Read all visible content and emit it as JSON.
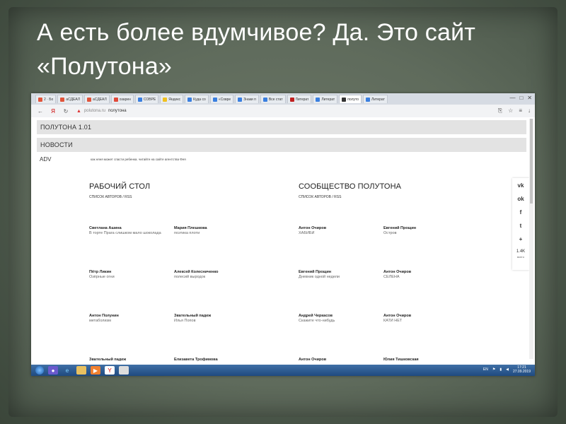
{
  "slide": {
    "title": "А есть более вдумчивое? Да. Это сайт «Полутона»"
  },
  "browser": {
    "tabs": [
      {
        "label": "2 · Бо",
        "color": "#e0543a"
      },
      {
        "label": "аСДЕАЛ",
        "color": "#e0543a"
      },
      {
        "label": "аСДЕАЛ",
        "color": "#e0543a"
      },
      {
        "label": "озарен",
        "color": "#e04a3a"
      },
      {
        "label": "СОВРЕ",
        "color": "#3a7fe0"
      },
      {
        "label": "Яндекс",
        "color": "#f0c020"
      },
      {
        "label": "Куда со",
        "color": "#3a7fe0"
      },
      {
        "label": "«Совре",
        "color": "#3a7fe0"
      },
      {
        "label": "Знаки п",
        "color": "#3a7fe0"
      },
      {
        "label": "Все стат",
        "color": "#3a7fe0"
      },
      {
        "label": "Литерат",
        "color": "#c02020"
      },
      {
        "label": "Литерат",
        "color": "#3a7fe0"
      },
      {
        "label": "полуто",
        "color": "#333333",
        "active": true
      },
      {
        "label": "Литерат",
        "color": "#3a7fe0"
      }
    ],
    "window_controls": {
      "minimize": "—",
      "maximize": "□",
      "close": "✕"
    },
    "address": {
      "domain": "polutona.ru",
      "title": "полутона"
    },
    "nav": {
      "back": "←",
      "yandex": "Я",
      "reload": "↻"
    }
  },
  "site": {
    "header_title": "ПОЛУТОНА 1.01",
    "news_label": "НОВОСТИ",
    "adv_label": "ADV",
    "adv_text": "как няня может спасти ребенка. читайте на сайте агентства Фея",
    "columns": [
      {
        "title": "РАБОЧИЙ СТОЛ",
        "subtitle": "СПИСОК АВТОРОВ / RSS",
        "authors": [
          {
            "name": "Светлана Ашина",
            "post": "В торте Прага слишком мало шоколада"
          },
          {
            "name": "Мария Плешкова",
            "post": "поэтика плоти"
          },
          {
            "name": "Пётр Ликин",
            "post": "Озёрные огни"
          },
          {
            "name": "Алексей Колесниченко",
            "post": "полесий выродок"
          },
          {
            "name": "Антон Полунин",
            "post": "метаболизм"
          },
          {
            "name": "Звательный падеж",
            "post": "Илья Попов"
          },
          {
            "name": "Звательный падеж",
            "post": ""
          },
          {
            "name": "Елизавета Трофимова",
            "post": ""
          }
        ]
      },
      {
        "title": "СООБЩЕСТВО ПОЛУТОНА",
        "subtitle": "СПИСОК АВТОРОВ / RSS",
        "authors": [
          {
            "name": "Антон Очиров",
            "post": "ХАБИБИ"
          },
          {
            "name": "Евгений Прощин",
            "post": "Остров"
          },
          {
            "name": "Евгений Прощин",
            "post": "Дневник одной недели"
          },
          {
            "name": "Антон Очиров",
            "post": "СЕЛЕНА"
          },
          {
            "name": "Андрей Черкасов",
            "post": "Скажите что-нибудь"
          },
          {
            "name": "Антон Очиров",
            "post": "КАТИ НЕТ"
          },
          {
            "name": "Антон Очиров",
            "post": ""
          },
          {
            "name": "Юлия Тишковская",
            "post": ""
          }
        ]
      }
    ],
    "share": {
      "vk": "vk",
      "ok": "ok",
      "fb": "f",
      "tw": "t",
      "plus": "+",
      "count": "1.4K",
      "count_label": "всего"
    }
  },
  "taskbar": {
    "lang": "EN",
    "time": "17:21",
    "date": "27.09.2019"
  }
}
